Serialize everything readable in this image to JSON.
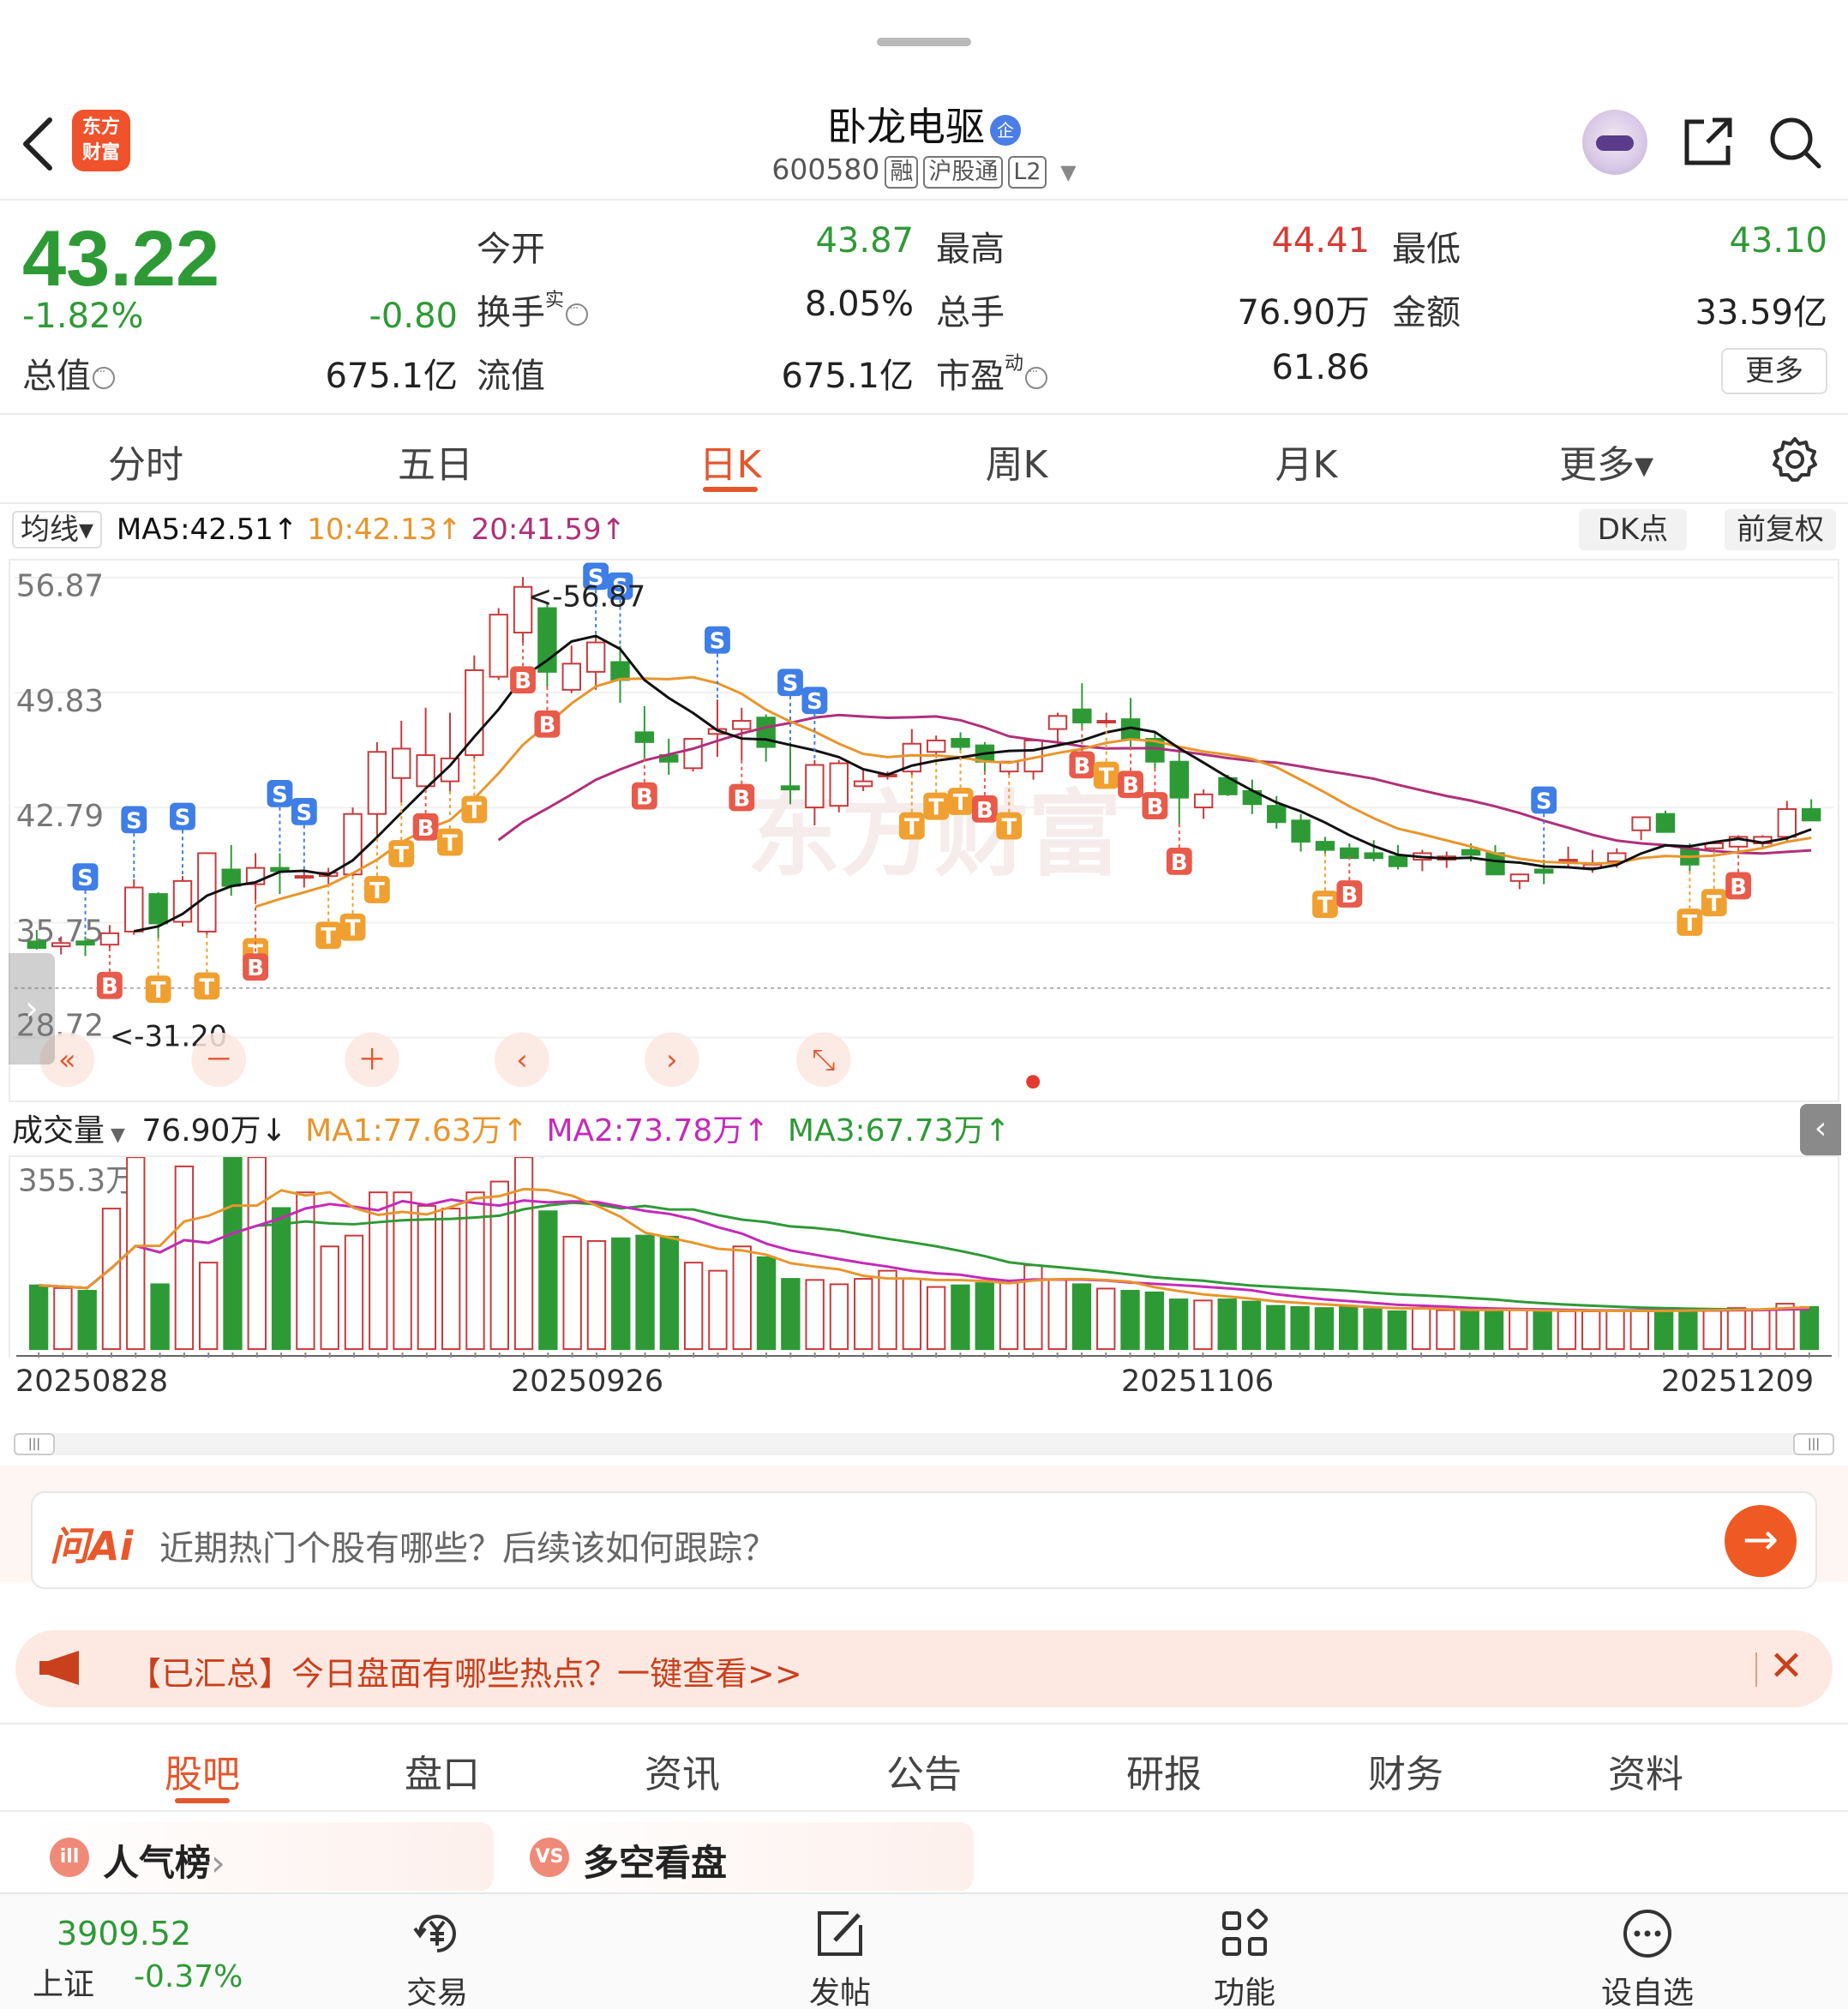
{
  "header": {
    "logo_text_line1": "东方",
    "logo_text_line2": "财富",
    "stock_name": "卧龙电驱",
    "badge": "企",
    "code": "600580",
    "tags": [
      "融",
      "沪股通",
      "L2"
    ]
  },
  "quote": {
    "price": "43.22",
    "change_pct": "-1.82%",
    "change": "-0.80",
    "open_label": "今开",
    "open": "43.87",
    "high_label": "最高",
    "high": "44.41",
    "low_label": "最低",
    "low": "43.10",
    "turnover_label": "换手",
    "turnover_sup": "实",
    "turnover": "8.05%",
    "vol_label": "总手",
    "vol": "76.90万",
    "amount_label": "金额",
    "amount": "33.59亿",
    "mktcap_label": "总值",
    "mktcap": "675.1亿",
    "float_label": "流值",
    "float": "675.1亿",
    "pe_label": "市盈",
    "pe_sup": "动",
    "pe": "61.86",
    "more": "更多"
  },
  "period_tabs": [
    "分时",
    "五日",
    "日K",
    "周K",
    "月K",
    "更多▾"
  ],
  "ma": {
    "label": "均线▾",
    "ma5": "MA5:42.51↑",
    "ma10": "10:42.13↑",
    "ma20": "20:41.59↑",
    "dk": "DK点",
    "fq": "前复权",
    "colors": {
      "ma5": "#111111",
      "ma10": "#e8952c",
      "ma20": "#b0307a"
    }
  },
  "volume": {
    "label": "成交量",
    "value": "76.90万↓",
    "ma1": "MA1:77.63万↑",
    "ma2": "MA2:73.78万↑",
    "ma3": "MA3:67.73万↑",
    "colors": {
      "ma1": "#e8952c",
      "ma2": "#c42ab8",
      "ma3": "#2e9a36"
    }
  },
  "chart_data": {
    "type": "candlestick",
    "y_ticks": [
      "56.87",
      "49.83",
      "42.79",
      "35.75",
      "28.72"
    ],
    "ylim": [
      28.72,
      56.87
    ],
    "max_label": "<-56.87",
    "min_label": "<-31.20",
    "dates": [
      "20250828",
      "20250926",
      "20251106",
      "20251209"
    ],
    "vol_tick": "355.3万",
    "candles": [
      [
        34.6,
        35.3,
        34.1,
        34.2
      ],
      [
        34.3,
        34.9,
        33.8,
        34.5
      ],
      [
        34.6,
        34.9,
        33.7,
        34.4
      ],
      [
        34.4,
        35.6,
        34.2,
        35.1
      ],
      [
        35.2,
        38.4,
        35.0,
        37.9
      ],
      [
        37.5,
        37.6,
        34.8,
        35.7
      ],
      [
        35.8,
        38.6,
        35.5,
        38.3
      ],
      [
        35.2,
        40.0,
        35.0,
        40.0
      ],
      [
        39.0,
        40.5,
        37.4,
        38.0
      ],
      [
        38.1,
        40.0,
        37.1,
        39.1
      ],
      [
        39.1,
        40.0,
        37.5,
        38.9
      ],
      [
        38.6,
        38.9,
        37.9,
        38.6
      ],
      [
        38.6,
        39.1,
        38.1,
        38.8
      ],
      [
        38.7,
        42.8,
        38.6,
        42.4
      ],
      [
        42.4,
        46.8,
        40.9,
        46.2
      ],
      [
        44.6,
        48.1,
        43.1,
        46.4
      ],
      [
        44.1,
        48.9,
        43.9,
        46.0
      ],
      [
        44.4,
        48.6,
        43.8,
        45.8
      ],
      [
        46.0,
        52.1,
        45.8,
        51.2
      ],
      [
        50.8,
        55.0,
        50.6,
        54.6
      ],
      [
        53.5,
        56.9,
        52.9,
        56.3
      ],
      [
        55.0,
        55.3,
        50.2,
        51.1
      ],
      [
        50.0,
        52.7,
        49.8,
        51.6
      ],
      [
        51.1,
        53.3,
        50.0,
        52.9
      ],
      [
        51.7,
        52.7,
        49.2,
        50.6
      ],
      [
        47.4,
        49.0,
        45.8,
        46.8
      ],
      [
        46.0,
        47.0,
        44.8,
        45.6
      ],
      [
        45.2,
        47.0,
        45.0,
        47.0
      ],
      [
        47.3,
        49.4,
        45.9,
        47.6
      ],
      [
        47.6,
        48.9,
        45.7,
        48.1
      ],
      [
        48.3,
        48.5,
        45.6,
        46.5
      ],
      [
        44.1,
        46.8,
        43.0,
        43.9
      ],
      [
        42.8,
        45.7,
        41.7,
        45.4
      ],
      [
        42.9,
        45.7,
        42.5,
        45.5
      ],
      [
        44.1,
        45.1,
        43.8,
        44.4
      ],
      [
        44.7,
        45.0,
        44.5,
        44.8
      ],
      [
        45.0,
        47.6,
        44.8,
        46.7
      ],
      [
        46.2,
        47.2,
        46.0,
        46.9
      ],
      [
        47.0,
        47.4,
        46.3,
        46.5
      ],
      [
        46.6,
        46.8,
        45.0,
        45.6
      ],
      [
        45.0,
        45.5,
        44.8,
        45.6
      ],
      [
        45.0,
        47.0,
        44.5,
        46.9
      ],
      [
        47.6,
        48.6,
        46.7,
        48.4
      ],
      [
        48.8,
        50.4,
        47.7,
        48.0
      ],
      [
        48.0,
        48.6,
        47.9,
        48.1
      ],
      [
        48.2,
        49.5,
        46.5,
        47.0
      ],
      [
        47.0,
        47.4,
        45.2,
        45.6
      ],
      [
        45.6,
        46.2,
        41.8,
        43.4
      ],
      [
        42.8,
        43.9,
        42.1,
        43.6
      ],
      [
        44.6,
        44.8,
        43.5,
        43.6
      ],
      [
        43.8,
        44.5,
        42.4,
        43.0
      ],
      [
        42.9,
        43.5,
        41.5,
        41.9
      ],
      [
        42.0,
        42.4,
        40.1,
        40.7
      ],
      [
        40.7,
        41.0,
        40.0,
        40.2
      ],
      [
        40.3,
        40.6,
        39.8,
        39.7
      ],
      [
        40.0,
        40.8,
        39.5,
        39.7
      ],
      [
        39.8,
        40.5,
        39.0,
        39.2
      ],
      [
        39.6,
        40.2,
        38.9,
        40.0
      ],
      [
        39.6,
        40.1,
        39.1,
        39.8
      ],
      [
        40.2,
        40.6,
        39.5,
        39.9
      ],
      [
        40.0,
        40.5,
        38.9,
        38.7
      ],
      [
        38.3,
        38.7,
        37.8,
        38.7
      ],
      [
        39.0,
        39.6,
        38.1,
        38.8
      ],
      [
        39.5,
        40.4,
        39.1,
        39.6
      ],
      [
        39.1,
        40.2,
        38.8,
        39.3
      ],
      [
        39.5,
        40.3,
        39.1,
        40.0
      ],
      [
        41.4,
        41.5,
        40.8,
        42.2
      ],
      [
        42.4,
        42.6,
        41.3,
        41.3
      ],
      [
        40.3,
        40.6,
        38.9,
        39.3
      ],
      [
        40.3,
        40.7,
        40.1,
        40.6
      ],
      [
        40.4,
        41.1,
        40.3,
        41.0
      ],
      [
        40.6,
        41.1,
        40.3,
        41.0
      ],
      [
        41.0,
        43.2,
        40.7,
        42.7
      ],
      [
        42.7,
        43.3,
        42.1,
        42.0
      ]
    ],
    "volumes": [
      118,
      113,
      108,
      260,
      355,
      120,
      338,
      160,
      355,
      355,
      261,
      290,
      190,
      210,
      290,
      290,
      265,
      260,
      290,
      310,
      355,
      255,
      208,
      200,
      205,
      210,
      208,
      160,
      145,
      190,
      170,
      130,
      128,
      120,
      130,
      145,
      130,
      115,
      118,
      122,
      124,
      155,
      128,
      120,
      112,
      108,
      105,
      92,
      90,
      92,
      88,
      80,
      78,
      76,
      80,
      74,
      70,
      76,
      72,
      70,
      74,
      72,
      70,
      70,
      70,
      72,
      72,
      70,
      72,
      74,
      76,
      74,
      84,
      78
    ],
    "signals": [
      {
        "i": 2,
        "t": "S"
      },
      {
        "i": 3,
        "t": "B"
      },
      {
        "i": 4,
        "t": "S"
      },
      {
        "i": 5,
        "t": "T"
      },
      {
        "i": 6,
        "t": "S"
      },
      {
        "i": 7,
        "t": "T"
      },
      {
        "i": 9,
        "t": "T"
      },
      {
        "i": 9,
        "t": "B"
      },
      {
        "i": 10,
        "t": "S"
      },
      {
        "i": 11,
        "t": "S"
      },
      {
        "i": 12,
        "t": "T"
      },
      {
        "i": 13,
        "t": "T"
      },
      {
        "i": 14,
        "t": "T"
      },
      {
        "i": 15,
        "t": "T"
      },
      {
        "i": 16,
        "t": "B"
      },
      {
        "i": 17,
        "t": "T"
      },
      {
        "i": 18,
        "t": "T"
      },
      {
        "i": 20,
        "t": "B"
      },
      {
        "i": 21,
        "t": "B"
      },
      {
        "i": 23,
        "t": "S"
      },
      {
        "i": 24,
        "t": "S"
      },
      {
        "i": 25,
        "t": "B"
      },
      {
        "i": 28,
        "t": "S"
      },
      {
        "i": 29,
        "t": "B"
      },
      {
        "i": 31,
        "t": "S"
      },
      {
        "i": 32,
        "t": "S"
      },
      {
        "i": 36,
        "t": "T"
      },
      {
        "i": 37,
        "t": "T"
      },
      {
        "i": 38,
        "t": "T"
      },
      {
        "i": 39,
        "t": "B"
      },
      {
        "i": 40,
        "t": "T"
      },
      {
        "i": 43,
        "t": "B"
      },
      {
        "i": 44,
        "t": "T"
      },
      {
        "i": 45,
        "t": "B"
      },
      {
        "i": 46,
        "t": "B"
      },
      {
        "i": 47,
        "t": "B"
      },
      {
        "i": 53,
        "t": "T"
      },
      {
        "i": 54,
        "t": "B"
      },
      {
        "i": 62,
        "t": "S"
      },
      {
        "i": 68,
        "t": "T"
      },
      {
        "i": 69,
        "t": "T"
      },
      {
        "i": 70,
        "t": "B"
      }
    ]
  },
  "chart_controls": [
    "«",
    "－",
    "＋",
    "‹",
    "›",
    "⤡"
  ],
  "ai": {
    "logo": "问Ai",
    "placeholder": "近期热门个股有哪些？后续该如何跟踪？",
    "go": "→"
  },
  "notice": {
    "text": "【已汇总】今日盘面有哪些热点？一键查看>>",
    "close": "✕"
  },
  "sub_tabs": [
    "股吧",
    "盘口",
    "资讯",
    "公告",
    "研报",
    "财务",
    "资料"
  ],
  "cards": [
    {
      "icon": "ill",
      "title": "人气榜",
      "arrow": "›"
    },
    {
      "icon": "VS",
      "title": "多空看盘"
    }
  ],
  "bottom": {
    "index_value": "3909.52",
    "index_name": "上证",
    "index_change": "-0.37%",
    "items": [
      {
        "label": "交易",
        "icon": "yuan-icon"
      },
      {
        "label": "发帖",
        "icon": "edit-icon"
      },
      {
        "label": "功能",
        "icon": "grid-icon"
      },
      {
        "label": "设自选",
        "icon": "more-icon"
      }
    ]
  }
}
